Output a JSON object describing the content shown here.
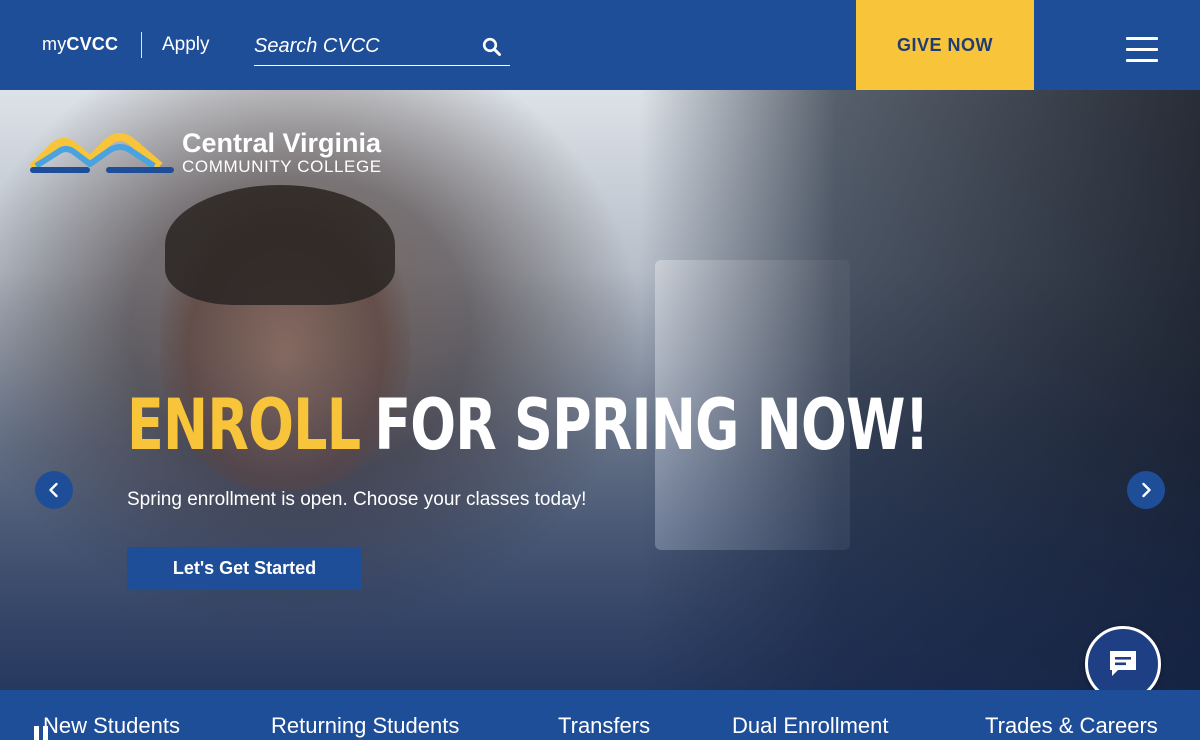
{
  "header": {
    "mycvcc_prefix": "my",
    "mycvcc_bold": "CVCC",
    "apply_label": "Apply",
    "search_placeholder": "Search CVCC",
    "give_label": "GIVE NOW"
  },
  "hero": {
    "logo_title": "Central Virginia",
    "logo_subtitle": "COMMUNITY COLLEGE",
    "headline_accent": "ENROLL",
    "headline_rest": "FOR SPRING NOW!",
    "subtext": "Spring enrollment is open. Choose your classes today!",
    "cta_label": "Let's Get Started"
  },
  "quicknav": {
    "items": [
      {
        "label": "New Students"
      },
      {
        "label": "Returning Students"
      },
      {
        "label": "Transfers"
      },
      {
        "label": "Dual Enrollment"
      },
      {
        "label": "Trades & Careers"
      }
    ]
  },
  "colors": {
    "brand_blue": "#1f4e99",
    "accent_yellow": "#f8c53a",
    "text_dark_blue": "#1f3c74"
  },
  "icons": {
    "search": "search-icon",
    "menu": "hamburger-menu-icon",
    "prev": "chevron-left-icon",
    "next": "chevron-right-icon",
    "chat": "chat-icon",
    "pause": "pause-icon"
  }
}
